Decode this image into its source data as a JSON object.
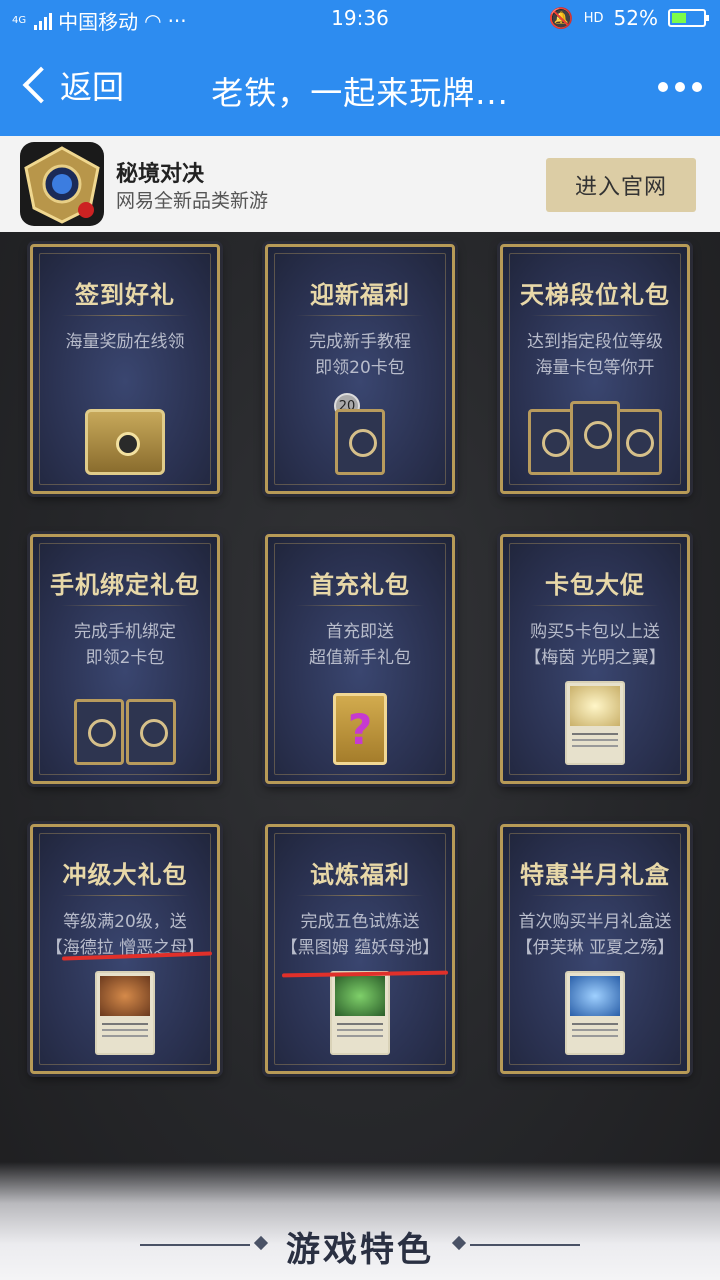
{
  "status": {
    "carrier": "中国移动",
    "network": "4G",
    "time": "19:36",
    "hd": "HD",
    "battery": "52%",
    "battery_level": 0.52
  },
  "nav": {
    "back_label": "返回",
    "title": "老铁，一起来玩牌...",
    "more_icon": "more-icon"
  },
  "app": {
    "name": "秘境对决",
    "desc": "网易全新品类新游",
    "button": "进入官网"
  },
  "cards": [
    {
      "title": "签到好礼",
      "lines": [
        "海量奖励在线领"
      ],
      "image": "chest"
    },
    {
      "title": "迎新福利",
      "lines": [
        "完成新手教程",
        "即领20卡包"
      ],
      "image": "pack-20",
      "badge": "20"
    },
    {
      "title": "天梯段位礼包",
      "lines": [
        "达到指定段位等级",
        "海量卡包等你开"
      ],
      "image": "packs-3"
    },
    {
      "title": "手机绑定礼包",
      "lines": [
        "完成手机绑定",
        "即领2卡包"
      ],
      "image": "packs-2"
    },
    {
      "title": "首充礼包",
      "lines": [
        "首充即送",
        "超值新手礼包"
      ],
      "image": "mystery-box"
    },
    {
      "title": "卡包大促",
      "lines": [
        "购买5卡包以上送",
        "【梅茵 光明之翼】"
      ],
      "image": "hero-card-light"
    },
    {
      "title": "冲级大礼包",
      "lines": [
        "等级满20级，送",
        "【海德拉 憎恶之母】"
      ],
      "image": "hero-card-hydra"
    },
    {
      "title": "试炼福利",
      "lines": [
        "完成五色试炼送",
        "【黑图姆 蕴妖母池】"
      ],
      "image": "hero-card-green"
    },
    {
      "title": "特惠半月礼盒",
      "lines": [
        "首次购买半月礼盒送",
        "【伊芙琳 亚夏之殇】"
      ],
      "image": "hero-card-blue"
    }
  ],
  "section": {
    "title": "游戏特色"
  },
  "colors": {
    "nav_bg": "#2d8cf0",
    "gold": "#b79a57",
    "underline_red": "#e0302a"
  }
}
